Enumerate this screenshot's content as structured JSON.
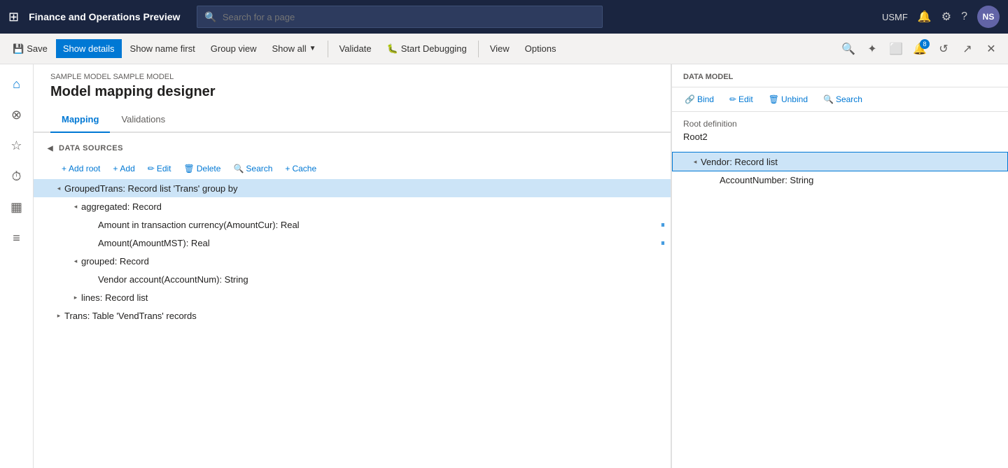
{
  "app": {
    "title": "Finance and Operations Preview",
    "grid_icon": "⊞",
    "search_placeholder": "Search for a page"
  },
  "top_nav_right": {
    "company": "USMF",
    "bell_icon": "🔔",
    "gear_icon": "⚙",
    "help_icon": "?",
    "avatar": "NS"
  },
  "toolbar": {
    "save_label": "Save",
    "show_details_label": "Show details",
    "show_name_first_label": "Show name first",
    "group_view_label": "Group view",
    "show_all_label": "Show all",
    "validate_label": "Validate",
    "start_debugging_label": "Start Debugging",
    "view_label": "View",
    "options_label": "Options"
  },
  "sidebar": {
    "icons": [
      "⌂",
      "☆",
      "⏱",
      "▦",
      "≡"
    ]
  },
  "page": {
    "breadcrumb": "SAMPLE MODEL SAMPLE MODEL",
    "title": "Model mapping designer"
  },
  "tabs": [
    {
      "label": "Mapping",
      "active": true
    },
    {
      "label": "Validations",
      "active": false
    }
  ],
  "data_sources": {
    "section_label": "DATA SOURCES",
    "toolbar_buttons": [
      {
        "icon": "+",
        "label": "Add root"
      },
      {
        "icon": "+",
        "label": "Add"
      },
      {
        "icon": "✏",
        "label": "Edit"
      },
      {
        "icon": "🗑",
        "label": "Delete"
      },
      {
        "icon": "🔍",
        "label": "Search"
      },
      {
        "icon": "+",
        "label": "Cache"
      }
    ],
    "tree": [
      {
        "label": "GroupedTrans: Record list 'Trans' group by",
        "level": 0,
        "expanded": true,
        "selected": true,
        "children": [
          {
            "label": "aggregated: Record",
            "level": 1,
            "expanded": true,
            "children": [
              {
                "label": "Amount in transaction currency(AmountCur): Real",
                "level": 2,
                "has_connector": true
              },
              {
                "label": "Amount(AmountMST): Real",
                "level": 2,
                "has_connector": true
              }
            ]
          },
          {
            "label": "grouped: Record",
            "level": 1,
            "expanded": true,
            "children": [
              {
                "label": "Vendor account(AccountNum): String",
                "level": 2
              }
            ]
          },
          {
            "label": "lines: Record list",
            "level": 1,
            "expanded": false
          }
        ]
      },
      {
        "label": "Trans: Table 'VendTrans' records",
        "level": 0,
        "expanded": false
      }
    ]
  },
  "data_model": {
    "section_label": "DATA MODEL",
    "toolbar_buttons": [
      {
        "icon": "🔗",
        "label": "Bind"
      },
      {
        "icon": "✏",
        "label": "Edit"
      },
      {
        "icon": "🗑",
        "label": "Unbind"
      },
      {
        "icon": "🔍",
        "label": "Search"
      }
    ],
    "root_definition_label": "Root definition",
    "root_definition_value": "Root2",
    "tree": [
      {
        "label": "Vendor: Record list",
        "level": 0,
        "expanded": true,
        "selected": true,
        "children": [
          {
            "label": "AccountNumber: String",
            "level": 1
          }
        ]
      }
    ]
  }
}
